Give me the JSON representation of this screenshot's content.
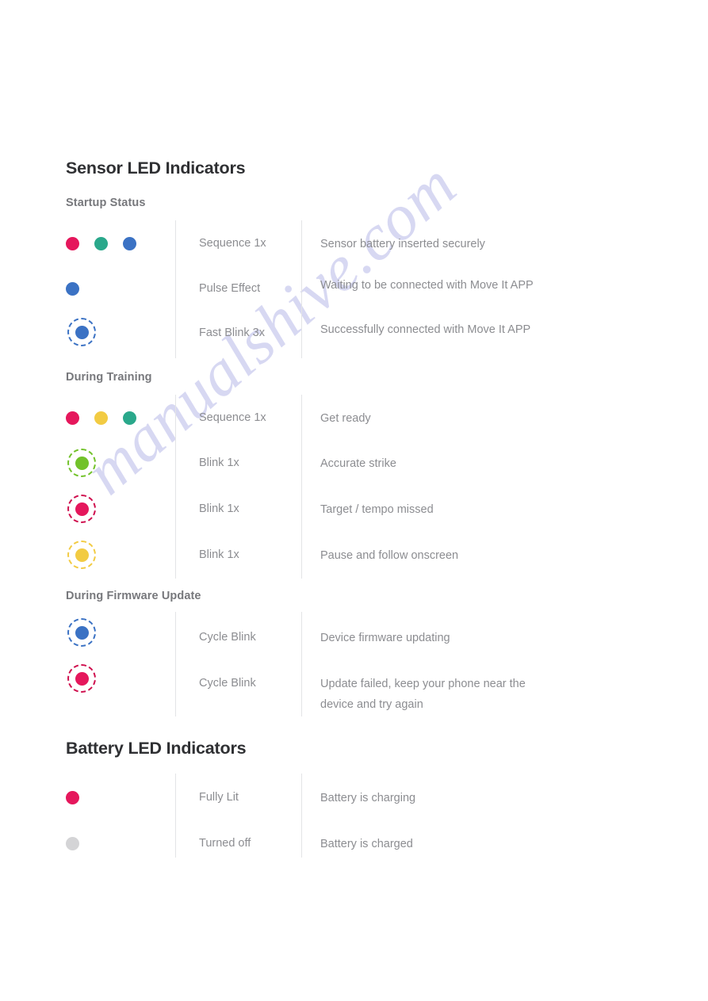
{
  "watermark": {
    "text": "manualshive.com",
    "color": "#c9caee"
  },
  "colors": {
    "pink": "#e8records",
    "crimson": "#e5175c",
    "teal": "#2aa88b",
    "blue": "#3b72c4",
    "yellow": "#f2cb43",
    "green": "#72c22a",
    "gray": "#d4d4d6",
    "heading": "#2f3033",
    "label": "#77787c",
    "body": "#8c8d91",
    "rule": "#e3e4e6"
  },
  "sections": [
    {
      "title": "Sensor LED Indicators",
      "groups": [
        {
          "label": "Startup Status",
          "rows": [
            {
              "leds": [
                {
                  "color": "#e5175c",
                  "ring": false
                },
                {
                  "color": "#2aa88b",
                  "ring": false
                },
                {
                  "color": "#3b72c4",
                  "ring": false
                }
              ],
              "mode": "Sequence 1x",
              "desc": "Sensor battery inserted securely"
            },
            {
              "leds": [
                {
                  "color": "#3b72c4",
                  "ring": false
                }
              ],
              "mode": "Pulse Effect",
              "desc": "Waiting to be connected with Move It APP"
            },
            {
              "leds": [
                {
                  "color": "#3b72c4",
                  "ring": true
                }
              ],
              "mode": "Fast Blink 3x",
              "desc": "Successfully connected with Move It APP"
            }
          ]
        },
        {
          "label": "During Training",
          "rows": [
            {
              "leds": [
                {
                  "color": "#e5175c",
                  "ring": false
                },
                {
                  "color": "#f2cb43",
                  "ring": false
                },
                {
                  "color": "#2aa88b",
                  "ring": false
                }
              ],
              "mode": "Sequence 1x",
              "desc": "Get ready"
            },
            {
              "leds": [
                {
                  "color": "#72c22a",
                  "ring": true
                }
              ],
              "mode": "Blink 1x",
              "desc": "Accurate strike"
            },
            {
              "leds": [
                {
                  "color": "#e5175c",
                  "ring": true
                }
              ],
              "mode": "Blink 1x",
              "desc": "Target / tempo missed"
            },
            {
              "leds": [
                {
                  "color": "#f2cb43",
                  "ring": true
                }
              ],
              "mode": "Blink 1x",
              "desc": "Pause and follow onscreen"
            }
          ]
        },
        {
          "label": "During Firmware Update",
          "rows": [
            {
              "leds": [
                {
                  "color": "#3b72c4",
                  "ring": true
                }
              ],
              "mode": "Cycle Blink",
              "desc": "Device firmware updating"
            },
            {
              "leds": [
                {
                  "color": "#e5175c",
                  "ring": true
                }
              ],
              "mode": "Cycle Blink",
              "desc": "Update failed, keep your phone near the device and try again"
            }
          ]
        }
      ]
    },
    {
      "title": "Battery LED Indicators",
      "groups": [
        {
          "label": "",
          "rows": [
            {
              "leds": [
                {
                  "color": "#e5175c",
                  "ring": false
                }
              ],
              "mode": "Fully Lit",
              "desc": "Battery is charging"
            },
            {
              "leds": [
                {
                  "color": "#d4d4d6",
                  "ring": false
                }
              ],
              "mode": "Turned off",
              "desc": "Battery is charged"
            }
          ]
        }
      ]
    }
  ]
}
